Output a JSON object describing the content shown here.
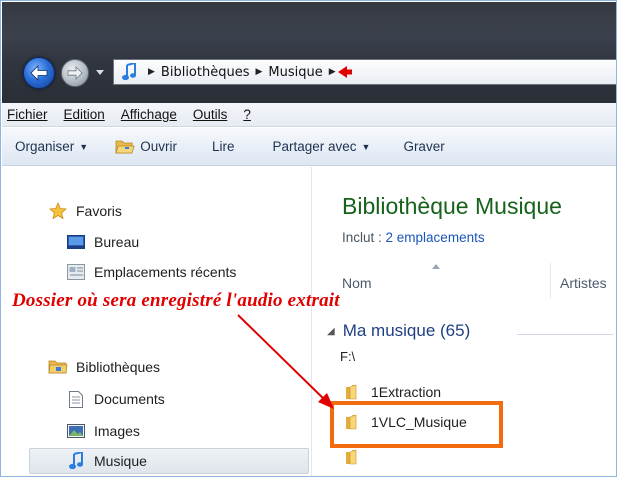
{
  "address": {
    "parts": [
      "Bibliothèques",
      "Musique"
    ],
    "music_icon": "music-note-icon"
  },
  "menu": {
    "items": [
      "Fichier",
      "Edition",
      "Affichage",
      "Outils",
      "?"
    ]
  },
  "command_bar": {
    "organiser": "Organiser",
    "ouvrir": "Ouvrir",
    "lire": "Lire",
    "partager": "Partager avec",
    "graver": "Graver"
  },
  "nav": {
    "favoris": "Favoris",
    "bureau": "Bureau",
    "recents": "Emplacements récents",
    "bibliotheques": "Bibliothèques",
    "documents": "Documents",
    "images": "Images",
    "musique": "Musique"
  },
  "library": {
    "title": "Bibliothèque Musique",
    "inclut_label": "Inclut : ",
    "inclut_link": "2 emplacements",
    "columns": [
      "Nom",
      "Artistes"
    ],
    "group": "Ma musique (65)",
    "drive": "F:\\",
    "folders": [
      "1Extraction",
      "1VLC_Musique"
    ]
  },
  "annotation": {
    "text": "Dossier où sera enregistré l'audio extrait",
    "color": "#e00000",
    "highlight_color": "#f26b0c"
  }
}
